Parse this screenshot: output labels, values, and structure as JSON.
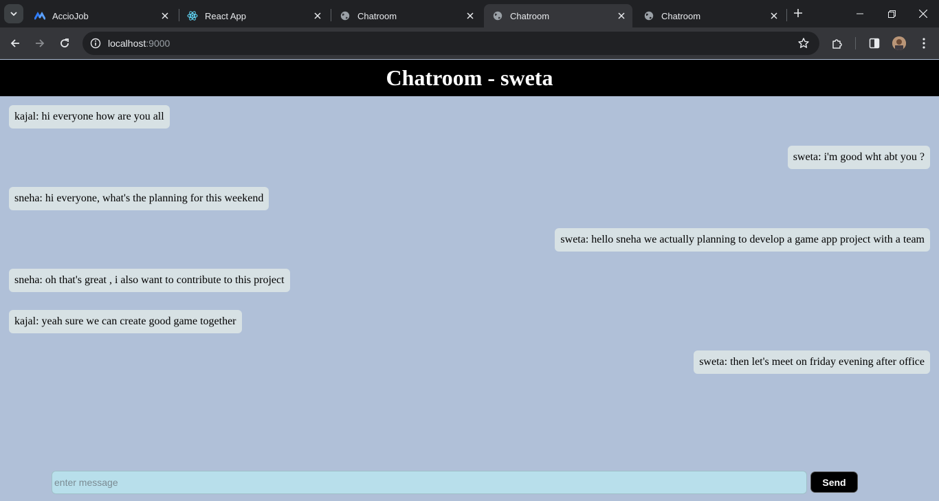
{
  "browser": {
    "tabs": [
      {
        "title": "AccioJob",
        "icon": "acciojob-icon",
        "active": false
      },
      {
        "title": "React App",
        "icon": "react-icon",
        "active": false
      },
      {
        "title": "Chatroom",
        "icon": "globe-icon",
        "active": false
      },
      {
        "title": "Chatroom",
        "icon": "globe-icon",
        "active": true
      },
      {
        "title": "Chatroom",
        "icon": "globe-icon",
        "active": false
      }
    ],
    "address": {
      "host": "localhost",
      "port": ":9000"
    }
  },
  "page": {
    "title": "Chatroom - sweta",
    "messages": [
      {
        "side": "left",
        "text": "kajal: hi everyone how are you all"
      },
      {
        "side": "right",
        "text": "sweta: i'm good wht abt you ?"
      },
      {
        "side": "left",
        "text": "sneha: hi everyone, what's the planning for this weekend"
      },
      {
        "side": "right",
        "text": "sweta: hello sneha we actually planning to develop a game app project with a team"
      },
      {
        "side": "left",
        "text": "sneha: oh that's great , i also want to contribute to this project"
      },
      {
        "side": "left",
        "text": "kajal: yeah sure we can create good game together"
      },
      {
        "side": "right",
        "text": "sweta: then let's meet on friday evening after office"
      }
    ],
    "composer": {
      "placeholder": "enter message",
      "value": ""
    },
    "send_label": "Send"
  },
  "colors": {
    "page_bg": "#b0c0d8",
    "header_bg": "#000000",
    "bubble_bg": "#d7e1e4",
    "input_bg": "#b8dfeb",
    "send_bg": "#000000"
  }
}
